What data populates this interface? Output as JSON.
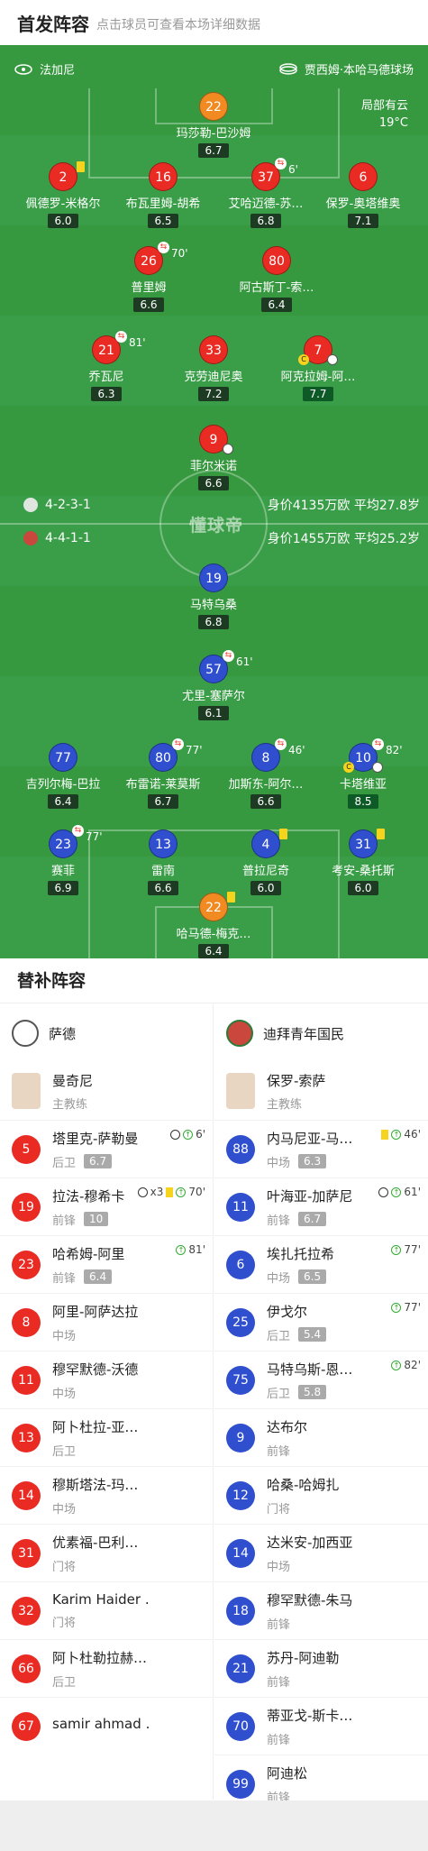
{
  "header": {
    "title": "首发阵容",
    "subtitle": "点击球员可查看本场详细数据"
  },
  "pitch": {
    "home_team": "法加尼",
    "venue": "贾西姆·本哈马德球场",
    "weather_text": "局部有云",
    "weather_temp": "19°C",
    "watermark": "懂球帝",
    "home_formation": "4-2-3-1",
    "home_stats": "身价4135万欧 平均27.8岁",
    "away_formation": "4-4-1-1",
    "away_stats": "身价1455万欧 平均25.2岁"
  },
  "home_players": [
    {
      "num": "22",
      "name": "玛莎勒-巴沙姆",
      "rating": "6.7"
    },
    {
      "num": "2",
      "name": "佩德罗-米格尔",
      "rating": "6.0"
    },
    {
      "num": "16",
      "name": "布瓦里姆-胡希",
      "rating": "6.5"
    },
    {
      "num": "37",
      "name": "艾哈迈德-苏…",
      "rating": "6.8",
      "sub_min": "6'"
    },
    {
      "num": "6",
      "name": "保罗-奥塔维奥",
      "rating": "7.1"
    },
    {
      "num": "26",
      "name": "普里姆",
      "rating": "6.6",
      "sub_min": "70'"
    },
    {
      "num": "80",
      "name": "阿古斯丁-索…",
      "rating": "6.4"
    },
    {
      "num": "21",
      "name": "乔瓦尼",
      "rating": "6.3",
      "sub_min": "81'"
    },
    {
      "num": "33",
      "name": "克劳迪尼奥",
      "rating": "7.2"
    },
    {
      "num": "7",
      "name": "阿克拉姆-阿…",
      "rating": "7.7"
    },
    {
      "num": "9",
      "name": "菲尔米诺",
      "rating": "6.6"
    }
  ],
  "away_players": [
    {
      "num": "19",
      "name": "马特乌桑",
      "rating": "6.8"
    },
    {
      "num": "57",
      "name": "尤里-塞萨尔",
      "rating": "6.1",
      "sub_min": "61'"
    },
    {
      "num": "77",
      "name": "吉列尔梅-巴拉",
      "rating": "6.4"
    },
    {
      "num": "80",
      "name": "布雷诺-莱莫斯",
      "rating": "6.7",
      "sub_min": "77'"
    },
    {
      "num": "8",
      "name": "加斯东-阿尔…",
      "rating": "6.6",
      "sub_min": "46'"
    },
    {
      "num": "10",
      "name": "卡塔维亚",
      "rating": "8.5",
      "sub_min": "82'"
    },
    {
      "num": "23",
      "name": "赛菲",
      "rating": "6.9",
      "sub_min": "77'"
    },
    {
      "num": "13",
      "name": "雷南",
      "rating": "6.6"
    },
    {
      "num": "4",
      "name": "普拉尼奇",
      "rating": "6.0"
    },
    {
      "num": "31",
      "name": "考安-桑托斯",
      "rating": "6.0"
    },
    {
      "num": "22",
      "name": "哈马德-梅克…",
      "rating": "6.4"
    }
  ],
  "subs_title": "替补阵容",
  "home_subs": {
    "team": "萨德",
    "coach": "曼奇尼",
    "coach_role": "主教练",
    "list": [
      {
        "num": "5",
        "name": "塔里克-萨勒曼",
        "pos": "后卫",
        "rating": "6.7",
        "ev": "6'"
      },
      {
        "num": "19",
        "name": "拉法-穆希卡",
        "pos": "前锋",
        "rating": "10",
        "ev": "70'",
        "goals": "x3"
      },
      {
        "num": "23",
        "name": "哈希姆-阿里",
        "pos": "前锋",
        "rating": "6.4",
        "ev": "81'"
      },
      {
        "num": "8",
        "name": "阿里-阿萨达拉",
        "pos": "中场"
      },
      {
        "num": "11",
        "name": "穆罕默德-沃德",
        "pos": "中场"
      },
      {
        "num": "13",
        "name": "阿卜杜拉-亚…",
        "pos": "后卫"
      },
      {
        "num": "14",
        "name": "穆斯塔法-玛…",
        "pos": "中场"
      },
      {
        "num": "31",
        "name": "优素福-巴利…",
        "pos": "门将"
      },
      {
        "num": "32",
        "name": "Karim Haider …",
        "pos": "门将"
      },
      {
        "num": "66",
        "name": "阿卜杜勒拉赫…",
        "pos": "后卫"
      },
      {
        "num": "67",
        "name": "samir ahmad …",
        "pos": ""
      }
    ]
  },
  "away_subs": {
    "team": "迪拜青年国民",
    "coach": "保罗-索萨",
    "coach_role": "主教练",
    "list": [
      {
        "num": "88",
        "name": "内马尼亚-马…",
        "pos": "中场",
        "rating": "6.3",
        "ev": "46'"
      },
      {
        "num": "11",
        "name": "叶海亚-加萨尼",
        "pos": "前锋",
        "rating": "6.7",
        "ev": "61'"
      },
      {
        "num": "6",
        "name": "埃扎托拉希",
        "pos": "中场",
        "rating": "6.5",
        "ev": "77'"
      },
      {
        "num": "25",
        "name": "伊戈尔",
        "pos": "后卫",
        "rating": "5.4",
        "ev": "77'"
      },
      {
        "num": "75",
        "name": "马特乌斯-恩…",
        "pos": "后卫",
        "rating": "5.8",
        "ev": "82'"
      },
      {
        "num": "9",
        "name": "达布尔",
        "pos": "前锋"
      },
      {
        "num": "12",
        "name": "哈桑-哈姆扎",
        "pos": "门将"
      },
      {
        "num": "14",
        "name": "达米安-加西亚",
        "pos": "中场"
      },
      {
        "num": "18",
        "name": "穆罕默德-朱马",
        "pos": "前锋"
      },
      {
        "num": "21",
        "name": "苏丹-阿迪勒",
        "pos": "前锋"
      },
      {
        "num": "70",
        "name": "蒂亚戈-斯卡…",
        "pos": "前锋"
      },
      {
        "num": "99",
        "name": "阿迪松",
        "pos": "前锋"
      }
    ]
  }
}
